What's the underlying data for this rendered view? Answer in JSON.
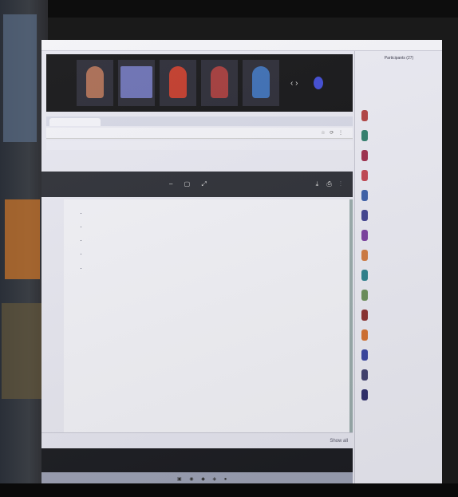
{
  "screenshot": "Photo of a monitor showing a video conference with a shared document",
  "window": {
    "title": "",
    "participants_header": "Participants (27)"
  },
  "video_tiles": [
    {
      "name": "",
      "color": "#a86b52"
    },
    {
      "name": "",
      "color": "#6a6fb2"
    },
    {
      "name": "",
      "color": "#c03a2a"
    },
    {
      "name": "",
      "color": "#a23a3a"
    },
    {
      "name": "",
      "color": "#3b6db3"
    }
  ],
  "browser": {
    "tab_label": "",
    "url": "",
    "nav_controls": "☆ ⟳ ⋮"
  },
  "viewer": {
    "title": "",
    "tools": "– ▢ ⤢",
    "right_tools": "⤓ ⎙ ⋮"
  },
  "document": {
    "lead": "",
    "bullets": [
      "",
      "",
      "",
      "",
      ""
    ]
  },
  "downloads": {
    "items": [
      "",
      "",
      "",
      ""
    ],
    "show_all": "Show all"
  },
  "participants": [
    {
      "name": "",
      "color": "#b04040"
    },
    {
      "name": "",
      "color": "#2f7d6b"
    },
    {
      "name": "",
      "color": "#9c2c4a"
    },
    {
      "name": "",
      "color": "#c0444f"
    },
    {
      "name": "",
      "color": "#3b5fa8"
    },
    {
      "name": "",
      "color": "#40428f"
    },
    {
      "name": "",
      "color": "#7a3f9e"
    },
    {
      "name": "",
      "color": "#d07a40"
    },
    {
      "name": "",
      "color": "#2b7f8c"
    },
    {
      "name": "",
      "color": "#6b8f5a"
    },
    {
      "name": "",
      "color": "#8a3030"
    },
    {
      "name": "",
      "color": "#d3702f"
    },
    {
      "name": "",
      "color": "#3845a0"
    },
    {
      "name": "",
      "color": "#40406e"
    },
    {
      "name": "",
      "color": "#2d2d6b"
    }
  ],
  "participants_footer": {
    "invite": "",
    "mute": "",
    "more": ""
  }
}
